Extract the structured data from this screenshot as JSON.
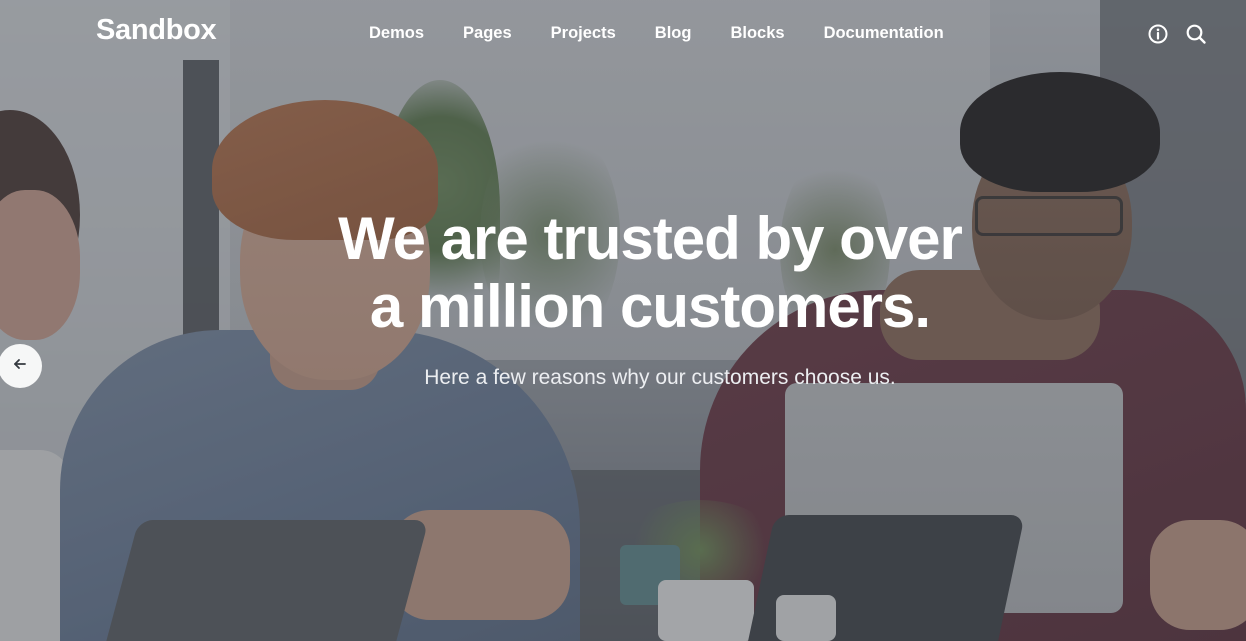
{
  "brand": {
    "logo_text": "Sandbox"
  },
  "nav": {
    "items": [
      {
        "label": "Demos"
      },
      {
        "label": "Pages"
      },
      {
        "label": "Projects"
      },
      {
        "label": "Blog"
      },
      {
        "label": "Blocks"
      },
      {
        "label": "Documentation"
      }
    ]
  },
  "header_icons": {
    "info": "info-icon",
    "search": "search-icon"
  },
  "hero": {
    "title_line1": "We are trusted by over",
    "title_line2": "a million customers.",
    "subtitle": "Here a few reasons why our customers choose us."
  },
  "slider": {
    "prev_icon": "arrow-left-icon"
  },
  "colors": {
    "text": "#ffffff",
    "overlay": "#3c4048"
  }
}
